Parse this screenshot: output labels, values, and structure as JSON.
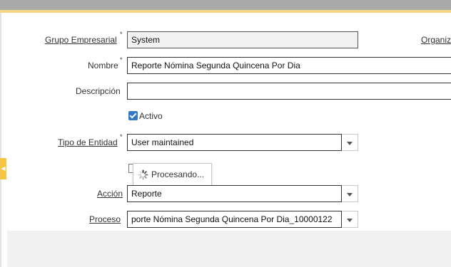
{
  "form": {
    "grupo_empresarial": {
      "label": "Grupo Empresarial",
      "value": "System"
    },
    "organization_link": "Organiz",
    "nombre": {
      "label": "Nombre",
      "value": "Reporte Nómina Segunda Quincena Por Dia"
    },
    "descripcion": {
      "label": "Descripción",
      "value": ""
    },
    "activo": {
      "label": "Activo",
      "checked": true
    },
    "tipo_entidad": {
      "label": "Tipo de Entidad",
      "value": "User maintained"
    },
    "accion": {
      "label": "Acción",
      "value": "Reporte"
    },
    "proceso": {
      "label": "Proceso",
      "value": "porte Nómina Segunda Quincena Por Dia_10000122"
    }
  },
  "loading": {
    "text": "Procesando..."
  },
  "required_marker": "*"
}
